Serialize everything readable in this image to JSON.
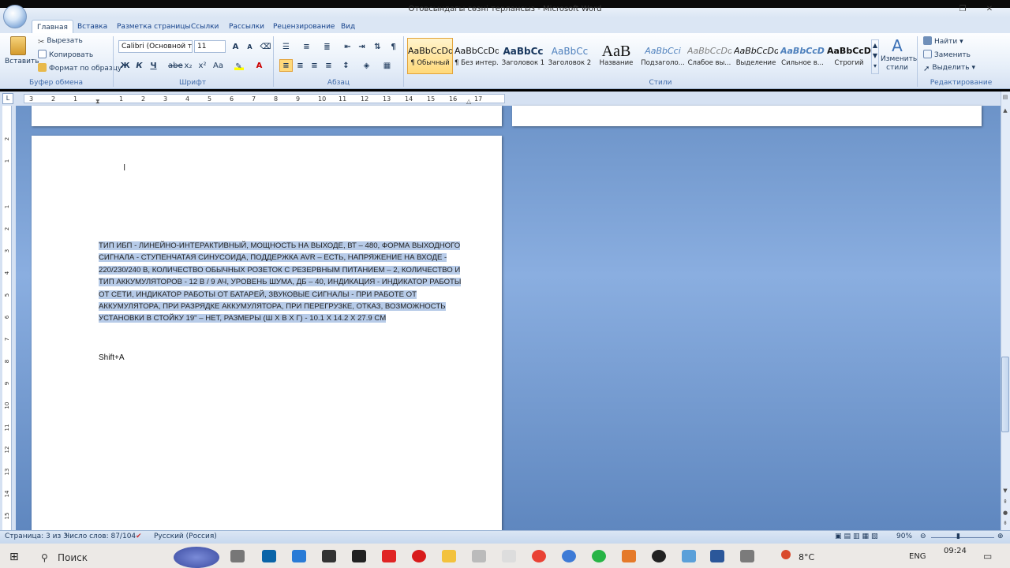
{
  "window": {
    "title": "Отовсындагы сөзні терлансыз - Microsoft Word"
  },
  "tabs": [
    "Главная",
    "Вставка",
    "Разметка страницы",
    "Ссылки",
    "Рассылки",
    "Рецензирование",
    "Вид"
  ],
  "clipboard": {
    "paste": "Вставить",
    "cut": "Вырезать",
    "copy": "Копировать",
    "format_painter": "Формат по образцу",
    "label": "Буфер обмена"
  },
  "font": {
    "name": "Calibri (Основной тек",
    "size": "11",
    "label": "Шрифт",
    "bold": "Ж",
    "italic": "К",
    "underline": "Ч",
    "strike": "abe",
    "sub": "x₂",
    "sup": "x²",
    "case": "Aa",
    "grow": "A",
    "shrink": "A"
  },
  "paragraph": {
    "label": "Абзац",
    "pilcrow": "¶"
  },
  "styles": {
    "label": "Стили",
    "items": [
      {
        "sample": "AaBbCcDd",
        "name": "¶ Обычный"
      },
      {
        "sample": "AaBbCcDd",
        "name": "¶ Без интер..."
      },
      {
        "sample": "AaBbCc",
        "name": "Заголовок 1"
      },
      {
        "sample": "AaBbCc",
        "name": "Заголовок 2"
      },
      {
        "sample": "AaB",
        "name": "Название"
      },
      {
        "sample": "AaBbCci",
        "name": "Подзаголо..."
      },
      {
        "sample": "AaBbCcDd",
        "name": "Слабое вы..."
      },
      {
        "sample": "AaBbCcDd",
        "name": "Выделение"
      },
      {
        "sample": "AaBbCcDc",
        "name": "Сильное в..."
      },
      {
        "sample": "AaBbCcDc",
        "name": "Строгий"
      }
    ],
    "change": "Изменить стили"
  },
  "editing": {
    "label": "Редактирование",
    "find": "Найти",
    "replace": "Заменить",
    "select": "Выделить"
  },
  "ruler": {
    "ticks": [
      "3",
      "2",
      "1",
      "1",
      "2",
      "3",
      "4",
      "5",
      "6",
      "7",
      "8",
      "9",
      "10",
      "11",
      "12",
      "13",
      "14",
      "15",
      "16",
      "17"
    ]
  },
  "vruler": {
    "ticks": [
      "2",
      "1",
      "1",
      "2",
      "3",
      "4",
      "5",
      "6",
      "7",
      "8",
      "9",
      "10",
      "11",
      "12",
      "13",
      "14",
      "15"
    ]
  },
  "document": {
    "selected_text": "ТИП ИБП - ЛИНЕЙНО-ИНТЕРАКТИВНЫЙ, МОЩНОСТЬ НА ВЫХОДЕ, ВТ – 480, ФОРМА ВЫХОДНОГО СИГНАЛА - СТУПЕНЧАТАЯ СИНУСОИДА, ПОДДЕРЖКА AVR – ЕСТЬ, НАПРЯЖЕНИЕ НА ВХОДЕ - 220/230/240 В, КОЛИЧЕСТВО ОБЫЧНЫХ РОЗЕТОК С РЕЗЕРВНЫМ ПИТАНИЕМ – 2, КОЛИЧЕСТВО И ТИП АККУМУЛЯТОРОВ - 12 В / 9 АЧ, УРОВЕНЬ ШУМА, ДБ – 40, ИНДИКАЦИЯ - ИНДИКАТОР РАБОТЫ ОТ СЕТИ, ИНДИКАТОР РАБОТЫ ОТ БАТАРЕЙ, ЗВУКОВЫЕ СИГНАЛЫ - ПРИ РАБОТЕ ОТ АККУМУЛЯТОРА, ПРИ РАЗРЯДКЕ АККУМУЛЯТОРА, ПРИ ПЕРЕГРУЗКЕ, ОТКАЗ, ВОЗМОЖНОСТЬ УСТАНОВКИ В СТОЙКУ 19\" – НЕТ, РАЗМЕРЫ (Ш Х В Х Г) - 10.1 Х 14.2 Х 27.9 СМ",
    "shortcut_text": "Shift+A"
  },
  "status": {
    "page": "Страница: 3 из 3",
    "words": "Число слов: 87/104",
    "language": "Русский (Россия)",
    "zoom": "90%"
  },
  "taskbar": {
    "search": "Поиск",
    "temp": "8°C",
    "lang": "ENG",
    "time": "09:24"
  },
  "colors": {
    "ribbon": "#dbe6f4",
    "doc_bg": "#7aa0d4",
    "highlight": "#b7cbe8",
    "selected_style": "#ffd97a"
  }
}
